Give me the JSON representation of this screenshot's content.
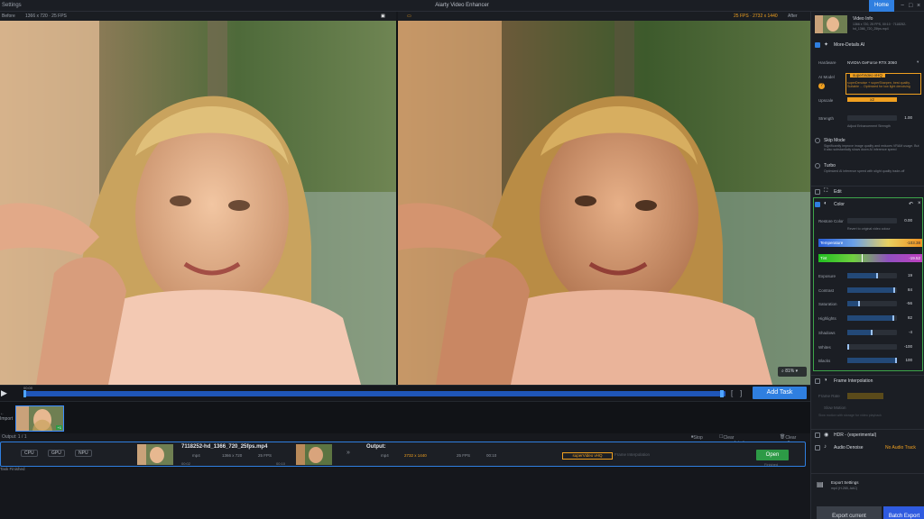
{
  "app": {
    "title": "Aiarty Video Enhancer",
    "settings_label": "Settings",
    "home_label": "Home",
    "window_controls": [
      "−",
      "□",
      "×"
    ]
  },
  "viewer": {
    "before_label": "Before",
    "before_meta": "1366 x 720 · 25 FPS",
    "after_label": "After",
    "after_meta": "25 FPS · 2732 x 1440",
    "zoom": "81%"
  },
  "timeline": {
    "time": "00:00",
    "add_task_label": "Add Task"
  },
  "filmstrip": {
    "import_label": "Import",
    "thumb_badge": "+1"
  },
  "tasks": {
    "count_label": "Output: 1 / 1",
    "stop_label": "Stop",
    "clear_completed_label": "Clear completed tasks",
    "clear_all_label": "Clear all",
    "row": {
      "hw": [
        "CPU",
        "GPU",
        "NPU"
      ],
      "filename": "7118252-hd_1366_720_25fps.mp4",
      "src_format": "mp4",
      "src_res": "1366 x 720",
      "src_fps": "25 FPS",
      "src_start": "00:02",
      "src_dur": "00:10",
      "output_label": "Output:",
      "out_format": "mp4",
      "out_res": "2732 x 1440",
      "out_fps": "25 FPS",
      "out_dur": "00:10",
      "model": "superVideo vHQ",
      "interp": "Frame Interpolation",
      "open_label": "Open",
      "open_sub": "Finished",
      "status": "Task Finished"
    }
  },
  "panel": {
    "video_info": {
      "title": "Video Info",
      "meta": "1366 x 720, 25 FPS, 00:10 · 7118252-hd_1366_720_25fps.mp4"
    },
    "more_details": "More-Details AI",
    "hardware_label": "Hardware",
    "hardware_value": "NVIDIA GeForce RTX 3060",
    "ai_model_label": "AI Model",
    "ai_model_value": "superVideo vHQ",
    "ai_model_desc": "superDenoise + superSharpen, best quality. Suitable ... Optimized for low light denoising",
    "upscale_label": "Upscale",
    "upscale_value": "x2",
    "strength_label": "Strength",
    "strength_value": "1.00",
    "strength_note": "Adjust Enhancement Strength",
    "skip_mode_label": "Skip Mode",
    "skip_mode_desc": "Significantly improve image quality and reduces VRAM usage. But it also substantially slows down AI inference speed",
    "turbo_label": "Turbo",
    "turbo_desc": "Optimized AI inference speed with slight quality trade-off",
    "edit_label": "Edit",
    "color_label": "Color",
    "restore_color_label": "Restore Color",
    "restore_color_value": "0.00",
    "restore_color_note": "Revert to original video colour",
    "temperature_label": "Temperature",
    "temperature_value": "-103.38",
    "tint_label": "Tint",
    "tint_value": "-19.52",
    "adjustments": [
      {
        "label": "Exposure",
        "value": "19",
        "level": 0.59
      },
      {
        "label": "Contrast",
        "value": "84",
        "level": 0.92
      },
      {
        "label": "Saturation",
        "value": "-56",
        "level": 0.22
      },
      {
        "label": "Highlights",
        "value": "82",
        "level": 0.91
      },
      {
        "label": "Shadows",
        "value": "-4",
        "level": 0.48
      },
      {
        "label": "Whites",
        "value": "-100",
        "level": 0.0
      },
      {
        "label": "Blacks",
        "value": "100",
        "level": 1.0
      }
    ],
    "frame_interp_label": "Frame Interpolation",
    "frame_rate_label": "Frame Rate",
    "slow_motion_label": "Slow Motion",
    "slow_motion_note": "Slow motion with storage for video playback",
    "hdr_label": "HDR - (experimental)",
    "audio_label": "Audio Denoise",
    "audio_value": "No Audio Track",
    "export_settings_label": "Export Settings",
    "export_settings_meta": "mp4 (H.265, AAC)",
    "export_current_label": "Export current",
    "batch_export_label": "Batch Export"
  },
  "colors": {
    "accent": "#2f7fe0",
    "highlight": "#f0a020",
    "open_green": "#2d9a46",
    "color_section_border": "#3da54a"
  }
}
